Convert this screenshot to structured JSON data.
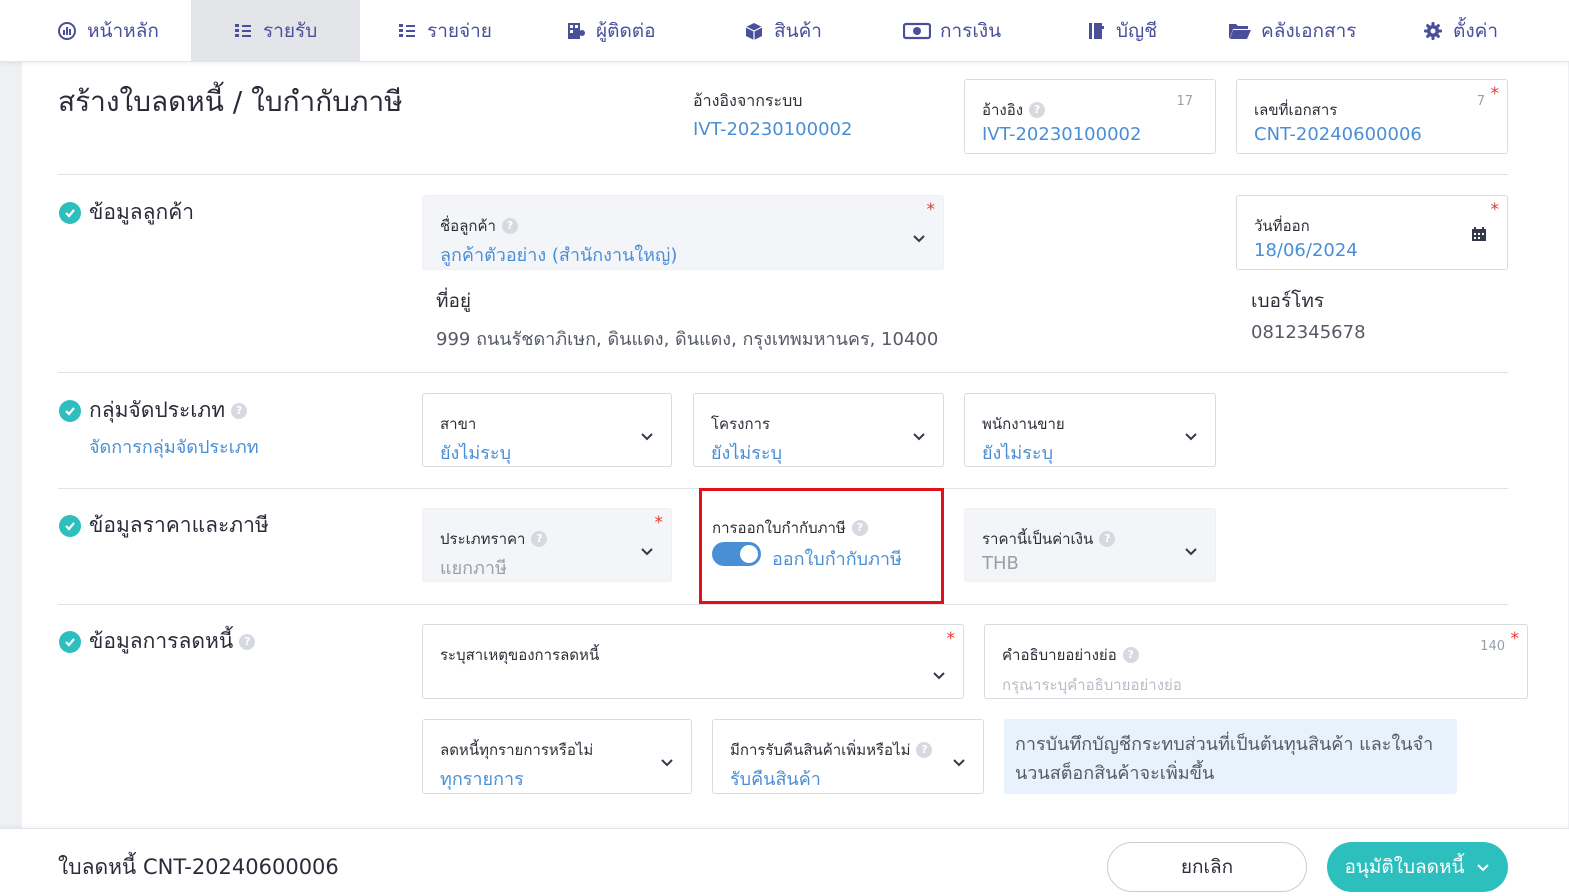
{
  "nav": {
    "items": [
      {
        "label": "หน้าหลัก",
        "icon": "dashboard-icon"
      },
      {
        "label": "รายรับ",
        "icon": "income-icon",
        "active": true
      },
      {
        "label": "รายจ่าย",
        "icon": "expense-icon"
      },
      {
        "label": "ผู้ติดต่อ",
        "icon": "contacts-icon"
      },
      {
        "label": "สินค้า",
        "icon": "box-icon"
      },
      {
        "label": "การเงิน",
        "icon": "money-icon"
      },
      {
        "label": "บัญชี",
        "icon": "ledger-icon"
      },
      {
        "label": "คลังเอกสาร",
        "icon": "folder-icon"
      },
      {
        "label": "ตั้งค่า",
        "icon": "gear-icon"
      }
    ]
  },
  "page": {
    "title": "สร้างใบลดหนี้ / ใบกำกับภาษี",
    "ref_system_label": "อ้างอิงจากระบบ",
    "ref_system_value": "IVT-20230100002",
    "reference": {
      "label": "อ้างอิง",
      "value": "IVT-20230100002",
      "count": "17"
    },
    "doc_number": {
      "label": "เลขที่เอกสาร",
      "value": "CNT-20240600006",
      "count": "7",
      "required": "*"
    }
  },
  "customer": {
    "section_title": "ข้อมูลลูกค้า",
    "name_label": "ชื่อลูกค้า",
    "name_value": "ลูกค้าตัวอย่าง (สำนักงานใหญ่)",
    "address_label": "ที่อยู่",
    "address_value": "999 ถนนรัชดาภิเษก, ดินแดง, ดินแดง, กรุงเทพมหานคร, 10400",
    "issue_date_label": "วันที่ออก",
    "issue_date_value": "18/06/2024",
    "phone_label": "เบอร์โทร",
    "phone_value": "0812345678"
  },
  "grouping": {
    "section_title": "กลุ่มจัดประเภท",
    "manage_link": "จัดการกลุ่มจัดประเภท",
    "branch_label": "สาขา",
    "branch_value": "ยังไม่ระบุ",
    "project_label": "โครงการ",
    "project_value": "ยังไม่ระบุ",
    "salesperson_label": "พนักงานขาย",
    "salesperson_value": "ยังไม่ระบุ"
  },
  "pricing": {
    "section_title": "ข้อมูลราคาและภาษี",
    "price_type_label": "ประเภทราคา",
    "price_type_value": "แยกภาษี",
    "tax_invoice_label": "การออกใบกำกับภาษี",
    "tax_invoice_toggle_label": "ออกใบกำกับภาษี",
    "tax_invoice_enabled": true,
    "currency_label": "ราคานี้เป็นค่าเงิน",
    "currency_value": "THB"
  },
  "credit": {
    "section_title": "ข้อมูลการลดหนี้",
    "reason_label": "ระบุสาเหตุของการลดหนี้",
    "reason_value": "",
    "description_label": "คำอธิบายอย่างย่อ",
    "description_placeholder": "กรุณาระบุคำอธิบายอย่างย่อ",
    "description_count": "140",
    "all_items_label": "ลดหนี้ทุกรายการหรือไม่",
    "all_items_value": "ทุกรายการ",
    "return_label": "มีการรับคืนสินค้าเพิ่มหรือไม่",
    "return_value": "รับคืนสินค้า",
    "info_text": "การบันทึกบัญชีกระทบส่วนที่เป็นต้นทุนสินค้า และในจำนวนสต็อกสินค้าจะเพิ่มขึ้น"
  },
  "footer": {
    "doc_label": "ใบลดหนี้ CNT-20240600006",
    "cancel_label": "ยกเลิก",
    "approve_label": "อนุมัติใบลดหนี้"
  },
  "colors": {
    "accent": "#2dbfbd",
    "link": "#4a8fd6",
    "nav_text": "#4a4f9a",
    "highlight": "#e3101a",
    "required": "#e53935"
  }
}
